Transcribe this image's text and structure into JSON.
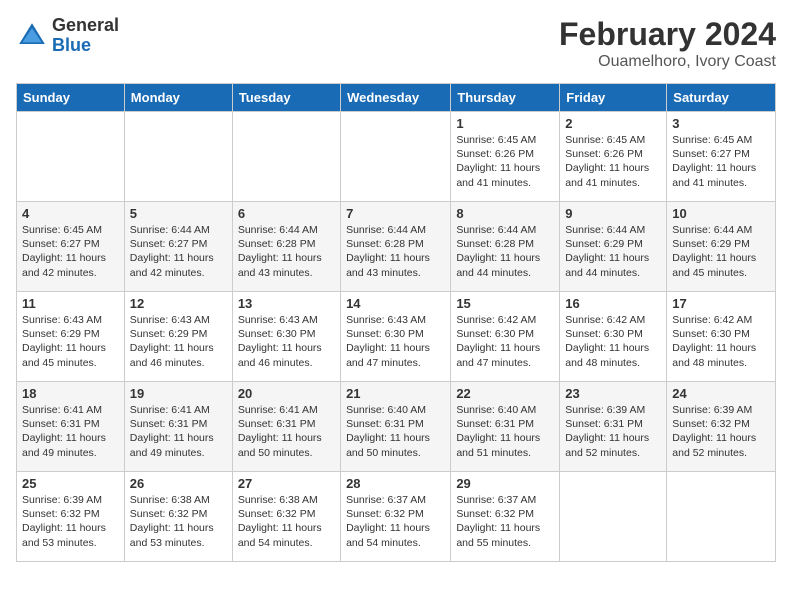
{
  "logo": {
    "general": "General",
    "blue": "Blue"
  },
  "title": "February 2024",
  "subtitle": "Ouamelhoro, Ivory Coast",
  "days_of_week": [
    "Sunday",
    "Monday",
    "Tuesday",
    "Wednesday",
    "Thursday",
    "Friday",
    "Saturday"
  ],
  "weeks": [
    [
      {
        "day": null
      },
      {
        "day": null
      },
      {
        "day": null
      },
      {
        "day": null
      },
      {
        "day": 1,
        "sunrise": "Sunrise: 6:45 AM",
        "sunset": "Sunset: 6:26 PM",
        "daylight": "Daylight: 11 hours and 41 minutes."
      },
      {
        "day": 2,
        "sunrise": "Sunrise: 6:45 AM",
        "sunset": "Sunset: 6:26 PM",
        "daylight": "Daylight: 11 hours and 41 minutes."
      },
      {
        "day": 3,
        "sunrise": "Sunrise: 6:45 AM",
        "sunset": "Sunset: 6:27 PM",
        "daylight": "Daylight: 11 hours and 41 minutes."
      }
    ],
    [
      {
        "day": 4,
        "sunrise": "Sunrise: 6:45 AM",
        "sunset": "Sunset: 6:27 PM",
        "daylight": "Daylight: 11 hours and 42 minutes."
      },
      {
        "day": 5,
        "sunrise": "Sunrise: 6:44 AM",
        "sunset": "Sunset: 6:27 PM",
        "daylight": "Daylight: 11 hours and 42 minutes."
      },
      {
        "day": 6,
        "sunrise": "Sunrise: 6:44 AM",
        "sunset": "Sunset: 6:28 PM",
        "daylight": "Daylight: 11 hours and 43 minutes."
      },
      {
        "day": 7,
        "sunrise": "Sunrise: 6:44 AM",
        "sunset": "Sunset: 6:28 PM",
        "daylight": "Daylight: 11 hours and 43 minutes."
      },
      {
        "day": 8,
        "sunrise": "Sunrise: 6:44 AM",
        "sunset": "Sunset: 6:28 PM",
        "daylight": "Daylight: 11 hours and 44 minutes."
      },
      {
        "day": 9,
        "sunrise": "Sunrise: 6:44 AM",
        "sunset": "Sunset: 6:29 PM",
        "daylight": "Daylight: 11 hours and 44 minutes."
      },
      {
        "day": 10,
        "sunrise": "Sunrise: 6:44 AM",
        "sunset": "Sunset: 6:29 PM",
        "daylight": "Daylight: 11 hours and 45 minutes."
      }
    ],
    [
      {
        "day": 11,
        "sunrise": "Sunrise: 6:43 AM",
        "sunset": "Sunset: 6:29 PM",
        "daylight": "Daylight: 11 hours and 45 minutes."
      },
      {
        "day": 12,
        "sunrise": "Sunrise: 6:43 AM",
        "sunset": "Sunset: 6:29 PM",
        "daylight": "Daylight: 11 hours and 46 minutes."
      },
      {
        "day": 13,
        "sunrise": "Sunrise: 6:43 AM",
        "sunset": "Sunset: 6:30 PM",
        "daylight": "Daylight: 11 hours and 46 minutes."
      },
      {
        "day": 14,
        "sunrise": "Sunrise: 6:43 AM",
        "sunset": "Sunset: 6:30 PM",
        "daylight": "Daylight: 11 hours and 47 minutes."
      },
      {
        "day": 15,
        "sunrise": "Sunrise: 6:42 AM",
        "sunset": "Sunset: 6:30 PM",
        "daylight": "Daylight: 11 hours and 47 minutes."
      },
      {
        "day": 16,
        "sunrise": "Sunrise: 6:42 AM",
        "sunset": "Sunset: 6:30 PM",
        "daylight": "Daylight: 11 hours and 48 minutes."
      },
      {
        "day": 17,
        "sunrise": "Sunrise: 6:42 AM",
        "sunset": "Sunset: 6:30 PM",
        "daylight": "Daylight: 11 hours and 48 minutes."
      }
    ],
    [
      {
        "day": 18,
        "sunrise": "Sunrise: 6:41 AM",
        "sunset": "Sunset: 6:31 PM",
        "daylight": "Daylight: 11 hours and 49 minutes."
      },
      {
        "day": 19,
        "sunrise": "Sunrise: 6:41 AM",
        "sunset": "Sunset: 6:31 PM",
        "daylight": "Daylight: 11 hours and 49 minutes."
      },
      {
        "day": 20,
        "sunrise": "Sunrise: 6:41 AM",
        "sunset": "Sunset: 6:31 PM",
        "daylight": "Daylight: 11 hours and 50 minutes."
      },
      {
        "day": 21,
        "sunrise": "Sunrise: 6:40 AM",
        "sunset": "Sunset: 6:31 PM",
        "daylight": "Daylight: 11 hours and 50 minutes."
      },
      {
        "day": 22,
        "sunrise": "Sunrise: 6:40 AM",
        "sunset": "Sunset: 6:31 PM",
        "daylight": "Daylight: 11 hours and 51 minutes."
      },
      {
        "day": 23,
        "sunrise": "Sunrise: 6:39 AM",
        "sunset": "Sunset: 6:31 PM",
        "daylight": "Daylight: 11 hours and 52 minutes."
      },
      {
        "day": 24,
        "sunrise": "Sunrise: 6:39 AM",
        "sunset": "Sunset: 6:32 PM",
        "daylight": "Daylight: 11 hours and 52 minutes."
      }
    ],
    [
      {
        "day": 25,
        "sunrise": "Sunrise: 6:39 AM",
        "sunset": "Sunset: 6:32 PM",
        "daylight": "Daylight: 11 hours and 53 minutes."
      },
      {
        "day": 26,
        "sunrise": "Sunrise: 6:38 AM",
        "sunset": "Sunset: 6:32 PM",
        "daylight": "Daylight: 11 hours and 53 minutes."
      },
      {
        "day": 27,
        "sunrise": "Sunrise: 6:38 AM",
        "sunset": "Sunset: 6:32 PM",
        "daylight": "Daylight: 11 hours and 54 minutes."
      },
      {
        "day": 28,
        "sunrise": "Sunrise: 6:37 AM",
        "sunset": "Sunset: 6:32 PM",
        "daylight": "Daylight: 11 hours and 54 minutes."
      },
      {
        "day": 29,
        "sunrise": "Sunrise: 6:37 AM",
        "sunset": "Sunset: 6:32 PM",
        "daylight": "Daylight: 11 hours and 55 minutes."
      },
      {
        "day": null
      },
      {
        "day": null
      }
    ]
  ]
}
